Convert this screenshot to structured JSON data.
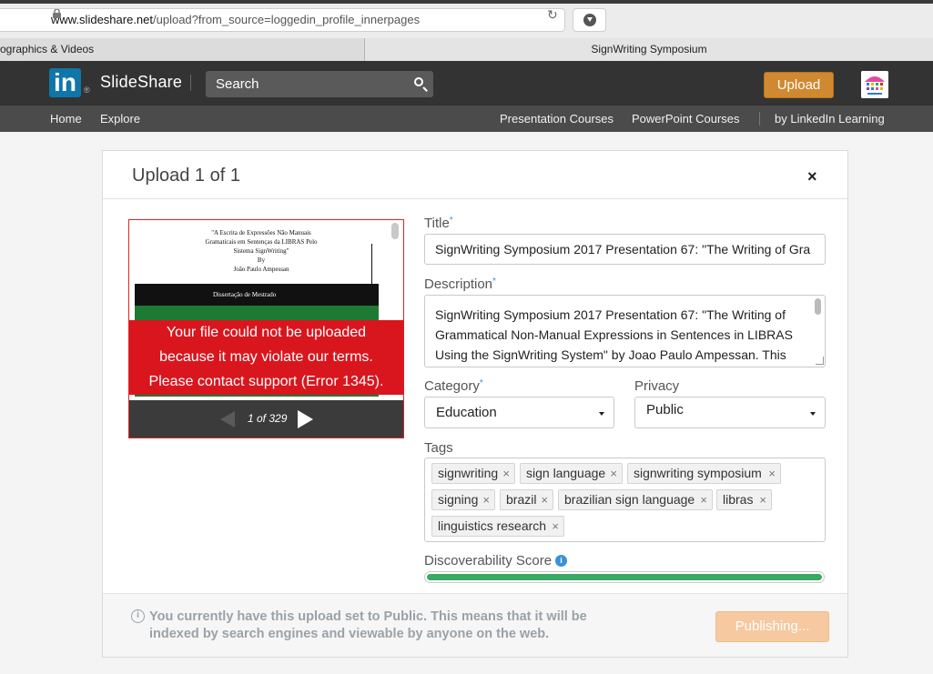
{
  "browser": {
    "url_host": "www.slideshare.net",
    "url_path": "/upload?from_source=loggedin_profile_innerpages",
    "tabs": [
      {
        "label": "ographics & Videos"
      },
      {
        "label": "SignWriting Symposium"
      }
    ]
  },
  "header": {
    "logo_in": "in",
    "logo_reg": "®",
    "logo_text": "SlideShare",
    "search_placeholder": "Search",
    "upload_label": "Upload"
  },
  "subnav": {
    "home": "Home",
    "explore": "Explore",
    "presentation_courses": "Presentation Courses",
    "powerpoint_courses": "PowerPoint Courses",
    "linkedin_learning": "by LinkedIn Learning"
  },
  "modal": {
    "title": "Upload 1 of 1",
    "close": "×",
    "preview": {
      "doc_lines": [
        "\"A Escrita de Expressões Não Manuais",
        "Gramaticais em Sentenças da LIBRAS Pelo",
        "Sistema SignWriting\"",
        "By",
        "João Paulo Ampessan"
      ],
      "doc_bar": "Dissertação de Mestrado",
      "error_line1": "Your file could not be uploaded",
      "error_line2": "because it may violate our terms.",
      "error_line3": "Please contact support (Error 1345).",
      "page_indicator": "1 of 329"
    },
    "form": {
      "title_label": "Title",
      "title_value": "SignWriting Symposium 2017 Presentation 67:  \"The Writing of Gra",
      "description_label": "Description",
      "description_value": "SignWriting Symposium 2017 Presentation 67:  \"The Writing of Grammatical Non-Manual Expressions in Sentences in LIBRAS Using the SignWriting System\" by Joao Paulo Ampessan. This",
      "required_mark": "*",
      "category_label": "Category",
      "category_value": "Education",
      "privacy_label": "Privacy",
      "privacy_value": "Public",
      "tags_label": "Tags",
      "tags": [
        "signwriting",
        "sign language",
        "signwriting symposium",
        "signing",
        "brazil",
        "brazilian sign language",
        "libras",
        "linguistics research"
      ],
      "tag_remove": "×",
      "score_label": "Discoverability Score",
      "score_info": "i",
      "score_value": 100
    },
    "footer": {
      "info_icon": "i",
      "notice_line1": "You currently have this upload set to Public. This means that it will be",
      "notice_line2": "indexed by search engines and viewable by anyone on the web.",
      "publish_label": "Publishing..."
    }
  },
  "colors": {
    "brand_linkedin": "#0e76a8",
    "upload_button": "#d08930",
    "error_red": "#d9161e",
    "score_green": "#3ba866",
    "publish_disabled": "#f6c9a0"
  }
}
